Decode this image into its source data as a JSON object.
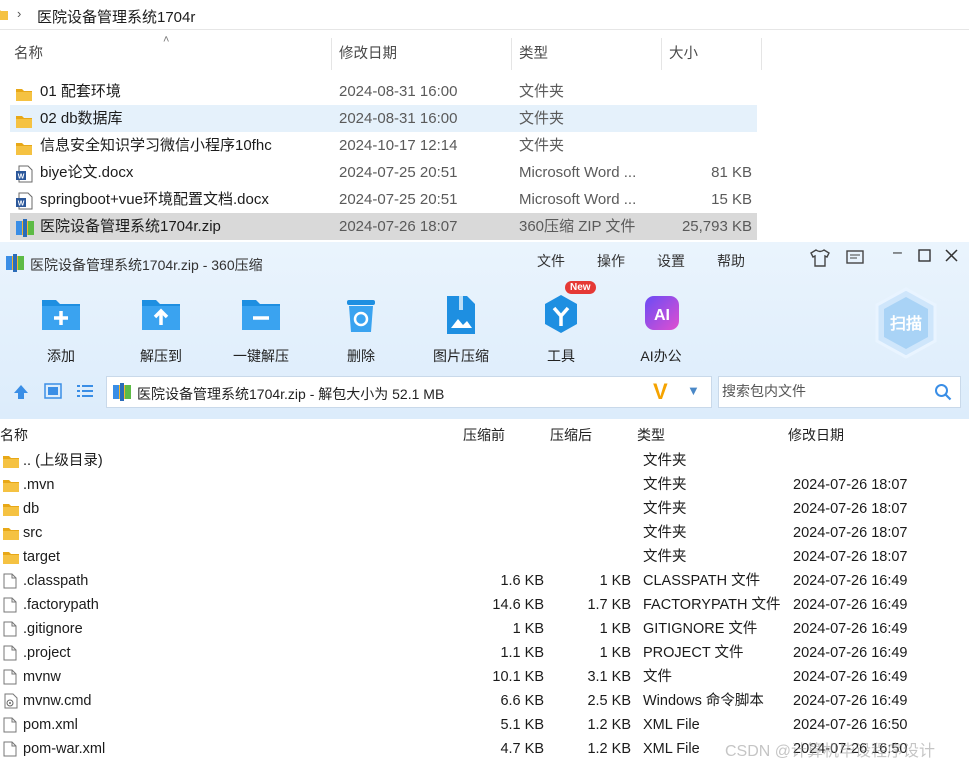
{
  "explorer": {
    "breadcrumb": "医院设备管理系统1704r",
    "columns": {
      "name": "名称",
      "modified": "修改日期",
      "type": "类型",
      "size": "大小"
    },
    "rows": [
      {
        "name": "01 配套环境",
        "date": "2024-08-31 16:00",
        "type": "文件夹",
        "size": "",
        "icon": "folder-icon"
      },
      {
        "name": "02 db数据库",
        "date": "2024-08-31 16:00",
        "type": "文件夹",
        "size": "",
        "icon": "folder-icon"
      },
      {
        "name": "信息安全知识学习微信小程序10fhc",
        "date": "2024-10-17 12:14",
        "type": "文件夹",
        "size": "",
        "icon": "folder-icon"
      },
      {
        "name": "biye论文.docx",
        "date": "2024-07-25 20:51",
        "type": "Microsoft Word ...",
        "size": "81 KB",
        "icon": "word-doc-icon"
      },
      {
        "name": "springboot+vue环境配置文档.docx",
        "date": "2024-07-25 20:51",
        "type": "Microsoft Word ...",
        "size": "15 KB",
        "icon": "word-doc-icon"
      },
      {
        "name": "医院设备管理系统1704r.zip",
        "date": "2024-07-26 18:07",
        "type": "360压缩 ZIP 文件",
        "size": "25,793 KB",
        "icon": "zip-archive-icon"
      }
    ]
  },
  "zip": {
    "window_title": "医院设备管理系统1704r.zip - 360压缩",
    "menu": [
      "文件",
      "操作",
      "设置",
      "帮助"
    ],
    "tools": [
      {
        "label": "添加",
        "icon": "add-folder-icon"
      },
      {
        "label": "解压到",
        "icon": "extract-to-icon"
      },
      {
        "label": "一键解压",
        "icon": "one-click-extract-icon"
      },
      {
        "label": "删除",
        "icon": "recycle-bin-icon"
      },
      {
        "label": "图片压缩",
        "icon": "image-compress-icon"
      },
      {
        "label": "工具",
        "icon": "tools-icon"
      },
      {
        "label": "AI办公",
        "icon": "ai-office-icon"
      }
    ],
    "new_badge": "New",
    "scan_label": "扫描",
    "ai_icon_text": "AI",
    "path_text": "医院设备管理系统1704r.zip - 解包大小为 52.1 MB",
    "v_mark": "V",
    "search_placeholder": "搜索包内文件",
    "columns": {
      "name": "名称",
      "packed": "压缩前",
      "compressed": "压缩后",
      "type": "类型",
      "modified": "修改日期"
    },
    "rows": [
      {
        "name": ".. (上级目录)",
        "before": "",
        "after": "",
        "type": "文件夹",
        "date": "",
        "icon": "folder-icon"
      },
      {
        "name": ".mvn",
        "before": "",
        "after": "",
        "type": "文件夹",
        "date": "2024-07-26 18:07",
        "icon": "folder-icon"
      },
      {
        "name": "db",
        "before": "",
        "after": "",
        "type": "文件夹",
        "date": "2024-07-26 18:07",
        "icon": "folder-icon"
      },
      {
        "name": "src",
        "before": "",
        "after": "",
        "type": "文件夹",
        "date": "2024-07-26 18:07",
        "icon": "folder-icon"
      },
      {
        "name": "target",
        "before": "",
        "after": "",
        "type": "文件夹",
        "date": "2024-07-26 18:07",
        "icon": "folder-icon"
      },
      {
        "name": ".classpath",
        "before": "1.6 KB",
        "after": "1 KB",
        "type": "CLASSPATH 文件",
        "date": "2024-07-26 16:49",
        "icon": "file-icon"
      },
      {
        "name": ".factorypath",
        "before": "14.6 KB",
        "after": "1.7 KB",
        "type": "FACTORYPATH 文件",
        "date": "2024-07-26 16:49",
        "icon": "file-icon"
      },
      {
        "name": ".gitignore",
        "before": "1 KB",
        "after": "1 KB",
        "type": "GITIGNORE 文件",
        "date": "2024-07-26 16:49",
        "icon": "file-icon"
      },
      {
        "name": ".project",
        "before": "1.1 KB",
        "after": "1 KB",
        "type": "PROJECT 文件",
        "date": "2024-07-26 16:49",
        "icon": "file-icon"
      },
      {
        "name": "mvnw",
        "before": "10.1 KB",
        "after": "3.1 KB",
        "type": "文件",
        "date": "2024-07-26 16:49",
        "icon": "file-icon"
      },
      {
        "name": "mvnw.cmd",
        "before": "6.6 KB",
        "after": "2.5 KB",
        "type": "Windows 命令脚本",
        "date": "2024-07-26 16:49",
        "icon": "cmd-script-icon"
      },
      {
        "name": "pom.xml",
        "before": "5.1 KB",
        "after": "1.2 KB",
        "type": "XML File",
        "date": "2024-07-26 16:50",
        "icon": "file-icon"
      },
      {
        "name": "pom-war.xml",
        "before": "4.7 KB",
        "after": "1.2 KB",
        "type": "XML File",
        "date": "2024-07-26 16:50",
        "icon": "file-icon"
      }
    ]
  },
  "watermark": "CSDN @计算机毕设程序设计",
  "colors": {
    "accent": "#1e8fe1",
    "folder": "#f5c242",
    "selection": "#e5f1fb",
    "zip_header": "#dcecfb"
  }
}
